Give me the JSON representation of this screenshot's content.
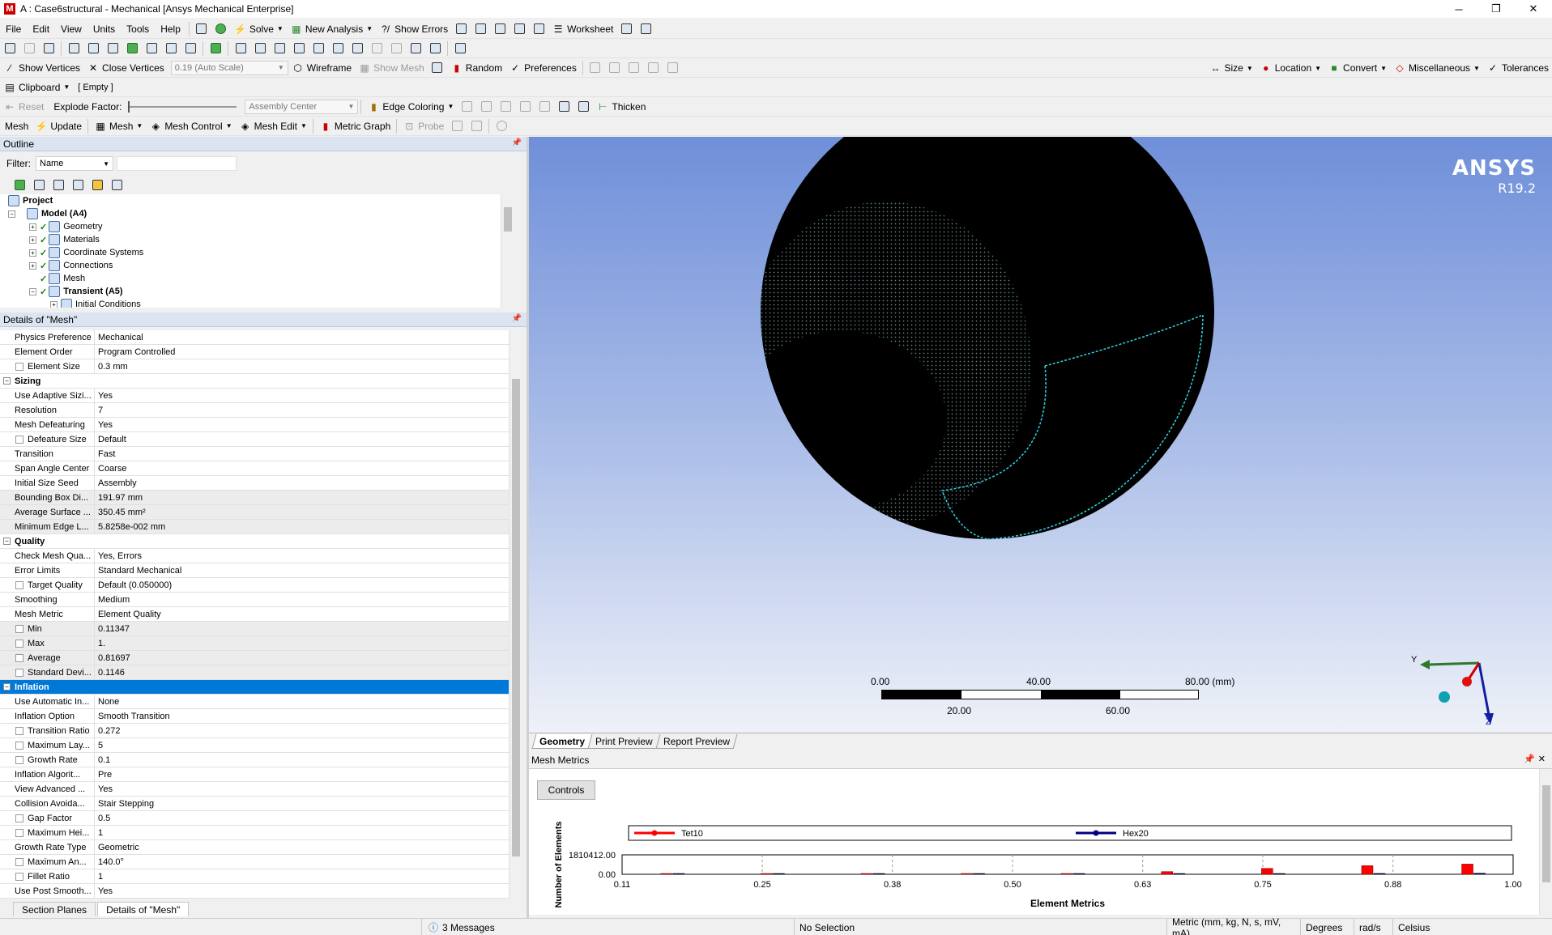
{
  "window": {
    "title": "A : Case6structural - Mechanical [Ansys Mechanical Enterprise]",
    "logo": "M",
    "minimize": "─",
    "maximize": "❐",
    "close": "✕"
  },
  "menu": [
    "File",
    "Edit",
    "View",
    "Units",
    "Tools",
    "Help"
  ],
  "toolbar1": {
    "solve": "Solve",
    "new_analysis": "New Analysis",
    "show_errors": "Show Errors",
    "worksheet": "Worksheet"
  },
  "toolbar3": {
    "show_vertices": "Show Vertices",
    "close_vertices": "Close Vertices",
    "scale_combo": "0.19 (Auto Scale)",
    "wireframe": "Wireframe",
    "show_mesh": "Show Mesh",
    "random": "Random",
    "preferences": "Preferences",
    "size": "Size",
    "location": "Location",
    "convert": "Convert",
    "miscellaneous": "Miscellaneous",
    "tolerances": "Tolerances"
  },
  "toolbar4": {
    "clipboard": "Clipboard",
    "clipboard_state": "[ Empty ]"
  },
  "toolbar5": {
    "reset": "Reset",
    "explode_factor": "Explode Factor:",
    "assembly_center": "Assembly Center",
    "edge_coloring": "Edge Coloring",
    "thicken": "Thicken"
  },
  "toolbar6": {
    "mesh_label": "Mesh",
    "update": "Update",
    "mesh": "Mesh",
    "mesh_control": "Mesh Control",
    "mesh_edit": "Mesh Edit",
    "metric_graph": "Metric Graph",
    "probe": "Probe"
  },
  "outline": {
    "title": "Outline",
    "filter_label": "Filter:",
    "filter_value": "Name",
    "tree": [
      {
        "label": "Project",
        "level": 0,
        "bold": true,
        "exp": ""
      },
      {
        "label": "Model (A4)",
        "level": 1,
        "bold": true,
        "exp": "−"
      },
      {
        "label": "Geometry",
        "level": 2,
        "bold": false,
        "exp": "+"
      },
      {
        "label": "Materials",
        "level": 2,
        "bold": false,
        "exp": "+"
      },
      {
        "label": "Coordinate Systems",
        "level": 2,
        "bold": false,
        "exp": "+"
      },
      {
        "label": "Connections",
        "level": 2,
        "bold": false,
        "exp": "+"
      },
      {
        "label": "Mesh",
        "level": 2,
        "bold": false,
        "exp": ""
      },
      {
        "label": "Transient (A5)",
        "level": 2,
        "bold": true,
        "exp": "−"
      },
      {
        "label": "Initial Conditions",
        "level": 3,
        "bold": false,
        "exp": "+"
      }
    ]
  },
  "details": {
    "title": "Details of \"Mesh\"",
    "rows": [
      {
        "type": "row",
        "name": "Physics Preference",
        "value": "Mechanical",
        "cb": false,
        "ro": false
      },
      {
        "type": "row",
        "name": "Element Order",
        "value": "Program Controlled",
        "cb": false,
        "ro": false
      },
      {
        "type": "row",
        "name": "Element Size",
        "value": "0.3 mm",
        "cb": true,
        "ro": false
      },
      {
        "type": "section",
        "name": "Sizing"
      },
      {
        "type": "row",
        "name": "Use Adaptive Sizi...",
        "value": "Yes",
        "cb": false,
        "ro": false
      },
      {
        "type": "row",
        "name": "Resolution",
        "value": "7",
        "cb": false,
        "ro": false
      },
      {
        "type": "row",
        "name": "Mesh Defeaturing",
        "value": "Yes",
        "cb": false,
        "ro": false
      },
      {
        "type": "row",
        "name": "Defeature Size",
        "value": "Default",
        "cb": true,
        "ro": false
      },
      {
        "type": "row",
        "name": "Transition",
        "value": "Fast",
        "cb": false,
        "ro": false
      },
      {
        "type": "row",
        "name": "Span Angle Center",
        "value": "Coarse",
        "cb": false,
        "ro": false
      },
      {
        "type": "row",
        "name": "Initial Size Seed",
        "value": "Assembly",
        "cb": false,
        "ro": false
      },
      {
        "type": "row",
        "name": "Bounding Box Di...",
        "value": "191.97 mm",
        "cb": false,
        "ro": true
      },
      {
        "type": "row",
        "name": "Average Surface ...",
        "value": "350.45 mm²",
        "cb": false,
        "ro": true
      },
      {
        "type": "row",
        "name": "Minimum Edge L...",
        "value": "5.8258e-002 mm",
        "cb": false,
        "ro": true
      },
      {
        "type": "section",
        "name": "Quality"
      },
      {
        "type": "row",
        "name": "Check Mesh Qua...",
        "value": "Yes, Errors",
        "cb": false,
        "ro": false
      },
      {
        "type": "row",
        "name": "Error Limits",
        "value": "Standard Mechanical",
        "cb": false,
        "ro": false
      },
      {
        "type": "row",
        "name": "Target Quality",
        "value": "Default (0.050000)",
        "cb": true,
        "ro": false
      },
      {
        "type": "row",
        "name": "Smoothing",
        "value": "Medium",
        "cb": false,
        "ro": false
      },
      {
        "type": "row",
        "name": "Mesh Metric",
        "value": "Element Quality",
        "cb": false,
        "ro": false
      },
      {
        "type": "row",
        "name": "Min",
        "value": "0.11347",
        "cb": true,
        "ro": true
      },
      {
        "type": "row",
        "name": "Max",
        "value": "1.",
        "cb": true,
        "ro": true
      },
      {
        "type": "row",
        "name": "Average",
        "value": "0.81697",
        "cb": true,
        "ro": true
      },
      {
        "type": "row",
        "name": "Standard Devi...",
        "value": "0.1146",
        "cb": true,
        "ro": true
      },
      {
        "type": "section",
        "name": "Inflation",
        "selected": true
      },
      {
        "type": "row",
        "name": "Use Automatic In...",
        "value": "None",
        "cb": false,
        "ro": false
      },
      {
        "type": "row",
        "name": "Inflation Option",
        "value": "Smooth Transition",
        "cb": false,
        "ro": false
      },
      {
        "type": "row",
        "name": "Transition Ratio",
        "value": "0.272",
        "cb": true,
        "ro": false
      },
      {
        "type": "row",
        "name": "Maximum Lay...",
        "value": "5",
        "cb": true,
        "ro": false
      },
      {
        "type": "row",
        "name": "Growth Rate",
        "value": "0.1",
        "cb": true,
        "ro": false
      },
      {
        "type": "row",
        "name": "Inflation Algorit...",
        "value": "Pre",
        "cb": false,
        "ro": false
      },
      {
        "type": "row",
        "name": "View Advanced ...",
        "value": "Yes",
        "cb": false,
        "ro": false
      },
      {
        "type": "row",
        "name": "Collision Avoida...",
        "value": "Stair Stepping",
        "cb": false,
        "ro": false
      },
      {
        "type": "row",
        "name": "Gap Factor",
        "value": "0.5",
        "cb": true,
        "ro": false
      },
      {
        "type": "row",
        "name": "Maximum Hei...",
        "value": "1",
        "cb": true,
        "ro": false
      },
      {
        "type": "row",
        "name": "Growth Rate Type",
        "value": "Geometric",
        "cb": false,
        "ro": false
      },
      {
        "type": "row",
        "name": "Maximum An...",
        "value": "140.0°",
        "cb": true,
        "ro": false
      },
      {
        "type": "row",
        "name": "Fillet Ratio",
        "value": "1",
        "cb": true,
        "ro": false
      },
      {
        "type": "row",
        "name": "Use Post Smooth...",
        "value": "Yes",
        "cb": false,
        "ro": false
      }
    ]
  },
  "left_tabs": {
    "section_planes": "Section Planes",
    "details_mesh": "Details of \"Mesh\""
  },
  "viewport": {
    "logo_name": "ANSYS",
    "logo_version": "R19.2",
    "scale_top": [
      "0.00",
      "40.00",
      "80.00 (mm)"
    ],
    "scale_bottom": [
      "20.00",
      "60.00"
    ],
    "triad_y": "Y",
    "triad_z": "Z"
  },
  "view_tabs": {
    "geometry": "Geometry",
    "print_preview": "Print Preview",
    "report_preview": "Report Preview"
  },
  "mesh_metrics": {
    "title": "Mesh Metrics",
    "controls": "Controls"
  },
  "chart_data": {
    "type": "bar",
    "ylabel": "Number of Elements",
    "xlabel": "Element Metrics",
    "y_ticks": [
      "0.00",
      "1810412.00"
    ],
    "x_ticks": [
      "0.11",
      "0.25",
      "0.38",
      "0.50",
      "0.63",
      "0.75",
      "0.88",
      "1.00"
    ],
    "xlim": [
      0.11,
      1.0
    ],
    "ylim": [
      0,
      1810412
    ],
    "series": [
      {
        "name": "Tet10",
        "color": "#ff0000",
        "x": [
          0.16,
          0.26,
          0.36,
          0.46,
          0.56,
          0.66,
          0.76,
          0.86,
          0.96
        ],
        "values": [
          0,
          0,
          0,
          0,
          60000,
          250000,
          550000,
          800000,
          950000
        ]
      },
      {
        "name": "Hex20",
        "color": "#000080",
        "x": [
          0.16,
          0.26,
          0.36,
          0.46,
          0.56,
          0.66,
          0.76,
          0.86,
          0.96
        ],
        "values": [
          30000,
          30000,
          30000,
          30000,
          40000,
          50000,
          60000,
          80000,
          100000
        ]
      }
    ]
  },
  "status": {
    "messages": "3 Messages",
    "selection": "No Selection",
    "units": "Metric (mm, kg, N, s, mV, mA)",
    "angle": "Degrees",
    "rate": "rad/s",
    "temp": "Celsius"
  }
}
